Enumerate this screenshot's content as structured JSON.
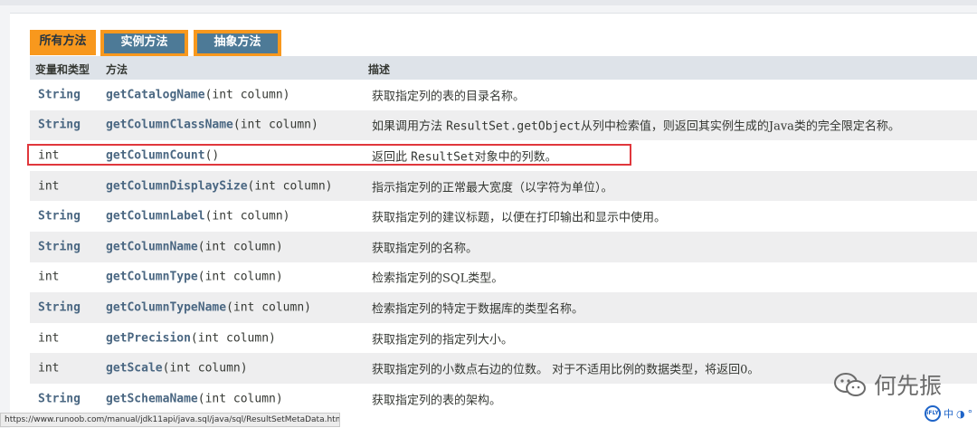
{
  "tabs": {
    "all": "所有方法",
    "instance": "实例方法",
    "abstract": "抽象方法"
  },
  "table": {
    "headers": [
      "变量和类型",
      "方法",
      "描述"
    ],
    "rows": [
      {
        "type": "String",
        "method": "getCatalogName",
        "params": "(int column)",
        "desc_pre": "获取指定列的表的目录名称。",
        "desc_code": "",
        "desc_post": ""
      },
      {
        "type": "String",
        "method": "getColumnClassName",
        "params": "(int column)",
        "desc_pre": "如果调用方法 ",
        "desc_code": "ResultSet.getObject",
        "desc_post": "从列中检索值，则返回其实例生成的Java类的完全限定名称。"
      },
      {
        "type": "int",
        "method": "getColumnCount",
        "params": "()",
        "desc_pre": "返回此 ",
        "desc_code": "ResultSet",
        "desc_post": "对象中的列数。"
      },
      {
        "type": "int",
        "method": "getColumnDisplaySize",
        "params": "(int column)",
        "desc_pre": "指示指定列的正常最大宽度（以字符为单位）。",
        "desc_code": "",
        "desc_post": ""
      },
      {
        "type": "String",
        "method": "getColumnLabel",
        "params": "(int column)",
        "desc_pre": "获取指定列的建议标题，以便在打印输出和显示中使用。",
        "desc_code": "",
        "desc_post": ""
      },
      {
        "type": "String",
        "method": "getColumnName",
        "params": "(int column)",
        "desc_pre": "获取指定列的名称。",
        "desc_code": "",
        "desc_post": ""
      },
      {
        "type": "int",
        "method": "getColumnType",
        "params": "(int column)",
        "desc_pre": "检索指定列的SQL类型。",
        "desc_code": "",
        "desc_post": ""
      },
      {
        "type": "String",
        "method": "getColumnTypeName",
        "params": "(int column)",
        "desc_pre": "检索指定列的特定于数据库的类型名称。",
        "desc_code": "",
        "desc_post": ""
      },
      {
        "type": "int",
        "method": "getPrecision",
        "params": "(int column)",
        "desc_pre": "获取指定列的指定列大小。",
        "desc_code": "",
        "desc_post": ""
      },
      {
        "type": "int",
        "method": "getScale",
        "params": "(int column)",
        "desc_pre": "获取指定列的小数点右边的位数。 对于不适用比例的数据类型，将返回0。",
        "desc_code": "",
        "desc_post": ""
      },
      {
        "type": "String",
        "method": "getSchemaName",
        "params": "(int column)",
        "desc_pre": "获取指定列的表的架构。",
        "desc_code": "",
        "desc_post": ""
      }
    ]
  },
  "statusbar": "https://www.runoob.com/manual/jdk11api/java.sql/java/sql/ResultSetMetaData.html#get...",
  "watermark": "何先振",
  "ime": {
    "badge": "iFLY",
    "mode": "中",
    "punct": "°"
  },
  "colors": {
    "tab_active": "#f8981d",
    "tab_inactive": "#4d7a97",
    "link": "#4a6782",
    "highlight_border": "#e0373c",
    "row_alt": "#eeeeef",
    "header_bg": "#dee3e9"
  }
}
